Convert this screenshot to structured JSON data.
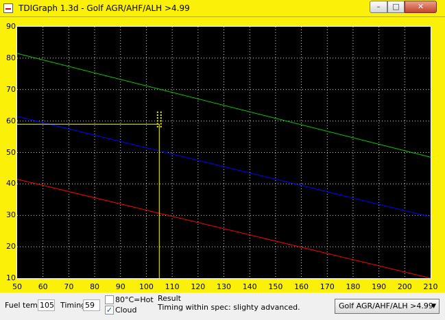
{
  "window": {
    "title": "TDIGraph 1.3d - Golf AGR/AHF/ALH >4.99",
    "minimize_glyph": "–",
    "maximize_glyph": "□",
    "close_glyph": "✕"
  },
  "colors": {
    "frame": "#fbf007",
    "plot_bg": "#000000",
    "grid": "#ffffff",
    "series_green": "#00cc00",
    "series_blue": "#0000ff",
    "series_red": "#ff0000",
    "marker": "#ffff00"
  },
  "chart_data": {
    "type": "line",
    "xlim": [
      50,
      210
    ],
    "ylim": [
      10,
      90
    ],
    "x_ticks": [
      50,
      60,
      70,
      80,
      90,
      100,
      110,
      120,
      130,
      140,
      150,
      160,
      170,
      180,
      190,
      200,
      210
    ],
    "y_ticks": [
      10,
      20,
      30,
      40,
      50,
      60,
      70,
      80,
      90
    ],
    "grid": true,
    "series": [
      {
        "color": "#00cc00",
        "x": [
          50,
          210
        ],
        "y": [
          81.5,
          48.5
        ]
      },
      {
        "color": "#0000ff",
        "x": [
          50,
          210
        ],
        "y": [
          61.5,
          29.5
        ]
      },
      {
        "color": "#ff0000",
        "x": [
          50,
          210
        ],
        "y": [
          41.5,
          10
        ]
      }
    ],
    "marker": {
      "x": 105,
      "y": 59
    }
  },
  "controls": {
    "fuel_temp_label": "Fuel temp",
    "fuel_temp_value": "105",
    "timing_label": "Timing",
    "timing_value": "59",
    "hot_label": "80°C=Hot",
    "hot_checked": false,
    "cloud_label": "Cloud",
    "cloud_checked": true,
    "result_label": "Result",
    "result_text": "Timing within spec: slighty advanced.",
    "model_selected": "Golf AGR/AHF/ALH >4.99",
    "model_arrow": "▼"
  }
}
